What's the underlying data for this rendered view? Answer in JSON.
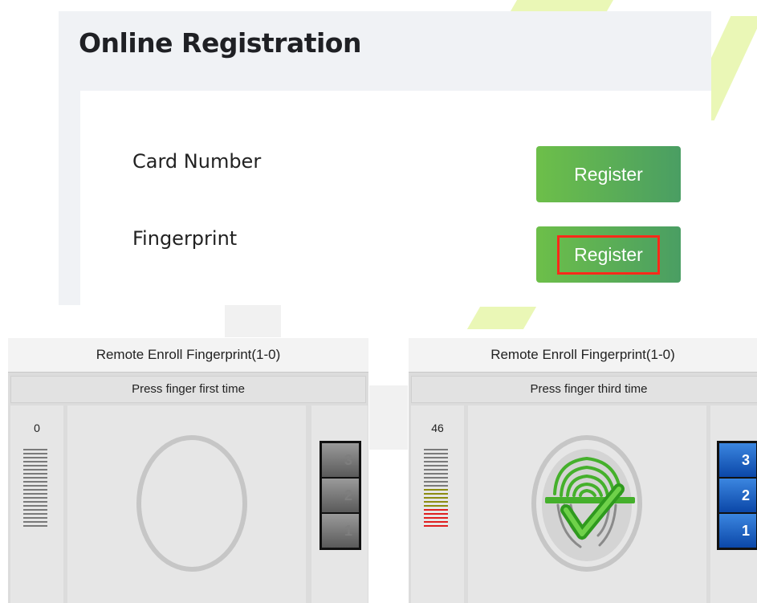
{
  "registration": {
    "title": "Online Registration",
    "rows": [
      {
        "label": "Card Number",
        "button": "Register"
      },
      {
        "label": "Fingerprint",
        "button": "Register"
      }
    ]
  },
  "enroll_windows": [
    {
      "title": "Remote Enroll Fingerprint(1-0)",
      "instruction": "Press finger first time",
      "score": "0",
      "quality_bars": {
        "total": 20,
        "olive": 0,
        "red": 0
      },
      "steps": [
        {
          "label": "3",
          "state": "inactive"
        },
        {
          "label": "2",
          "state": "inactive"
        },
        {
          "label": "1",
          "state": "inactive"
        }
      ],
      "icon": "empty-fingerprint-ring"
    },
    {
      "title": "Remote Enroll Fingerprint(1-0)",
      "instruction": "Press finger third time",
      "score": "46",
      "quality_bars": {
        "total": 20,
        "olive": 5,
        "red": 5
      },
      "steps": [
        {
          "label": "3",
          "state": "active"
        },
        {
          "label": "2",
          "state": "active"
        },
        {
          "label": "1",
          "state": "active"
        }
      ],
      "icon": "fingerprint-check-icon"
    }
  ],
  "colors": {
    "button_gradient_start": "#6dbf49",
    "button_gradient_end": "#4a9e63",
    "highlight_border": "#ff2a1a",
    "step_active": "#0b47a8",
    "fingerprint_green": "#3fae28"
  }
}
